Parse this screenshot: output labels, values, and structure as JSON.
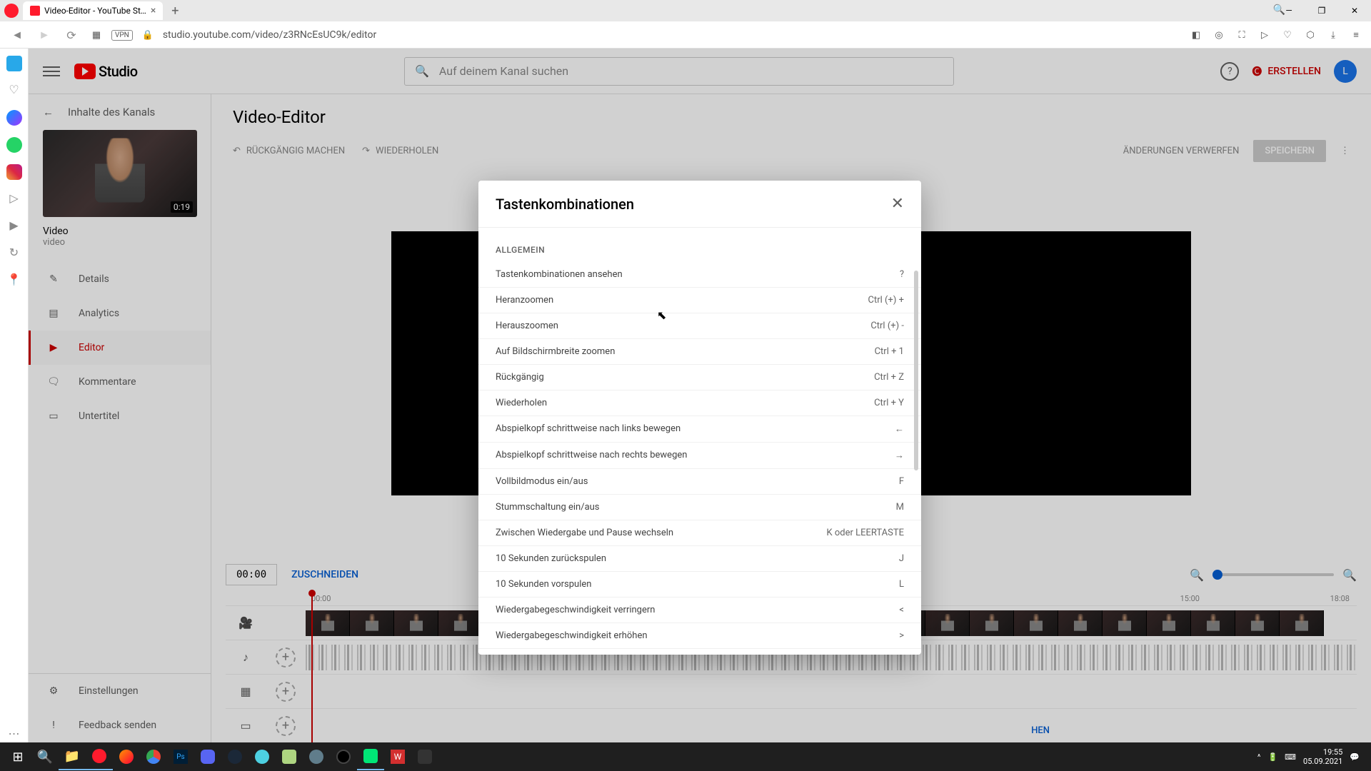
{
  "browser": {
    "tab_title": "Video-Editor - YouTube St…",
    "url": "studio.youtube.com/video/z3RNcEsUC9k/editor",
    "vpn": "VPN"
  },
  "header": {
    "logo_text": "Studio",
    "search_placeholder": "Auf deinem Kanal suchen",
    "create_label": "ERSTELLEN",
    "avatar_letter": "L"
  },
  "nav": {
    "back_label": "Inhalte des Kanals",
    "thumb_duration": "0:19",
    "video_title": "Video",
    "video_sub": "video",
    "items": [
      {
        "label": "Details",
        "icon": "✎"
      },
      {
        "label": "Analytics",
        "icon": "▤"
      },
      {
        "label": "Editor",
        "icon": "▶"
      },
      {
        "label": "Kommentare",
        "icon": "🗨"
      },
      {
        "label": "Untertitel",
        "icon": "▭"
      }
    ],
    "bottom": [
      {
        "label": "Einstellungen",
        "icon": "⚙"
      },
      {
        "label": "Feedback senden",
        "icon": "!"
      }
    ]
  },
  "editor": {
    "title": "Video-Editor",
    "undo": "RÜCKGÄNGIG MACHEN",
    "redo": "WIEDERHOLEN",
    "discard": "ÄNDERUNGEN VERWERFEN",
    "save": "SPEICHERN",
    "time": "00:00",
    "trim": "ZUSCHNEIDEN",
    "ruler": {
      "start": "00:00",
      "mid": "15:00",
      "end": "18:08"
    },
    "add_audio": "HEN"
  },
  "modal": {
    "title": "Tastenkombinationen",
    "section": "ALLGEMEIN",
    "shortcuts": [
      {
        "desc": "Tastenkombinationen ansehen",
        "key": "?"
      },
      {
        "desc": "Heranzoomen",
        "key": "Ctrl (+) +"
      },
      {
        "desc": "Herauszoomen",
        "key": "Ctrl (+) -"
      },
      {
        "desc": "Auf Bildschirmbreite zoomen",
        "key": "Ctrl + 1"
      },
      {
        "desc": "Rückgängig",
        "key": "Ctrl + Z"
      },
      {
        "desc": "Wiederholen",
        "key": "Ctrl + Y"
      },
      {
        "desc": "Abspielkopf schrittweise nach links bewegen",
        "key": "←"
      },
      {
        "desc": "Abspielkopf schrittweise nach rechts bewegen",
        "key": "→"
      },
      {
        "desc": "Vollbildmodus ein/aus",
        "key": "F"
      },
      {
        "desc": "Stummschaltung ein/aus",
        "key": "M"
      },
      {
        "desc": "Zwischen Wiedergabe und Pause wechseln",
        "key": "K oder LEERTASTE"
      },
      {
        "desc": "10 Sekunden zurückspulen",
        "key": "J"
      },
      {
        "desc": "10 Sekunden vorspulen",
        "key": "L"
      },
      {
        "desc": "Wiedergabegeschwindigkeit verringern",
        "key": "<"
      },
      {
        "desc": "Wiedergabegeschwindigkeit erhöhen",
        "key": ">"
      }
    ]
  },
  "taskbar": {
    "time": "19:55",
    "date": "05.09.2021"
  }
}
